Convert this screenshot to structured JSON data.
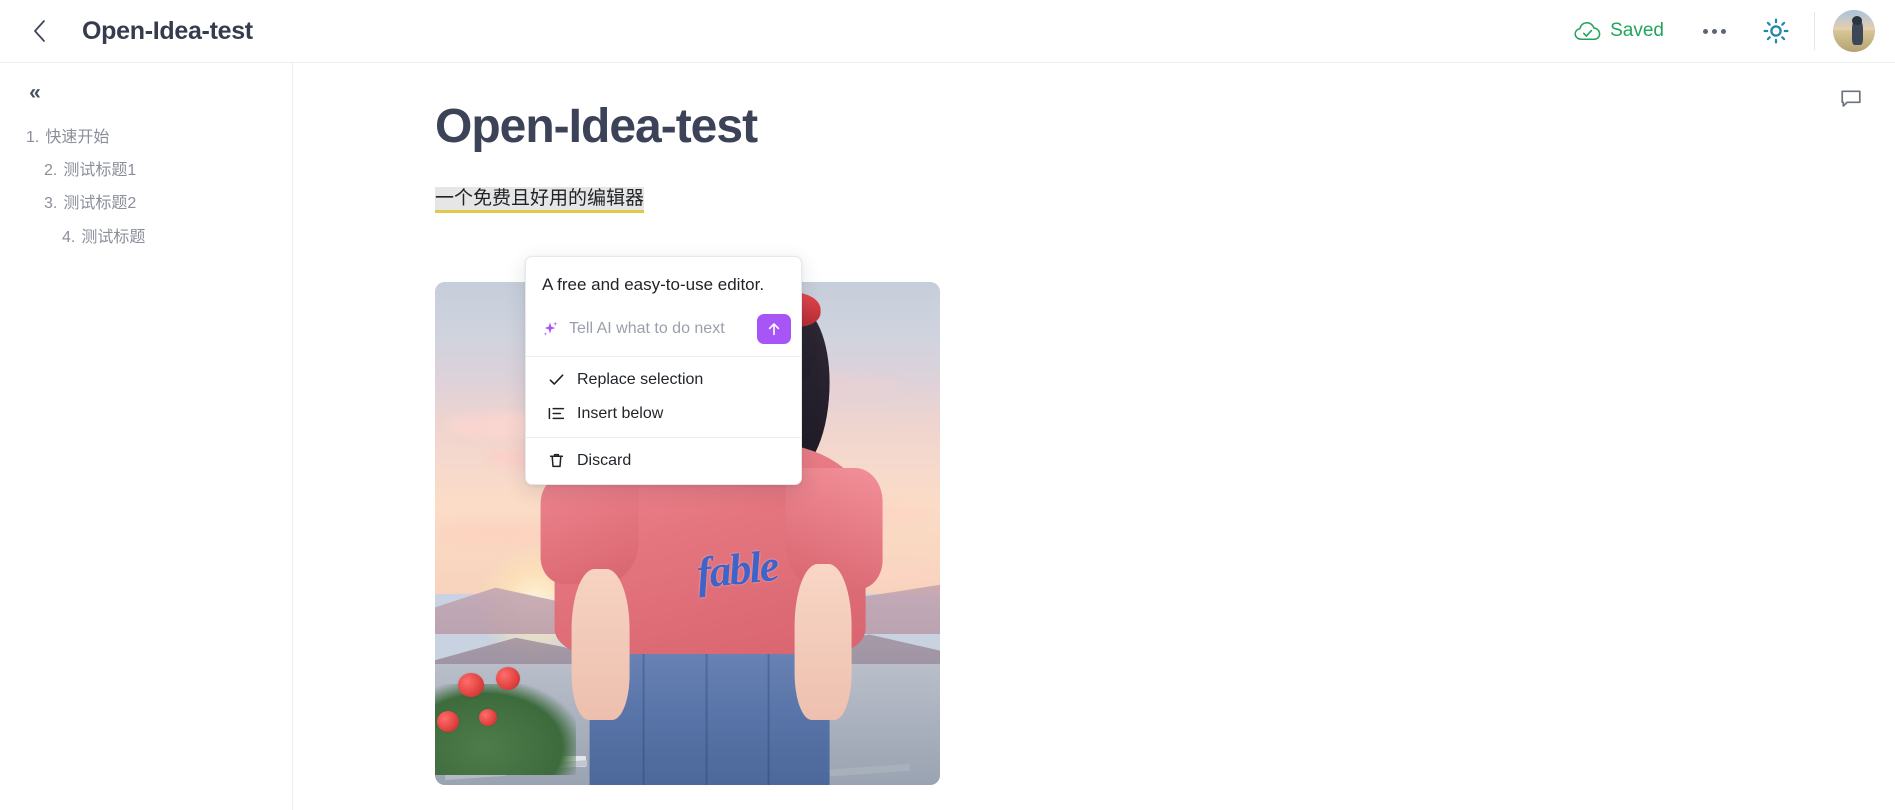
{
  "header": {
    "back_icon": "chevron-left-icon",
    "title": "Open-Idea-test",
    "save_status": "Saved",
    "save_icon": "cloud-check-icon",
    "more_icon": "ellipsis-icon",
    "theme_icon": "sun-icon",
    "avatar_icon": "user-avatar"
  },
  "sidebar": {
    "collapse_icon": "chevron-double-left-icon",
    "collapse_label": "«",
    "outline": [
      {
        "num": "1.",
        "label": "快速开始",
        "level": 0
      },
      {
        "num": "2.",
        "label": "测试标题1",
        "level": 1
      },
      {
        "num": "3.",
        "label": "测试标题2",
        "level": 1
      },
      {
        "num": "4.",
        "label": "测试标题",
        "level": 2
      }
    ]
  },
  "content": {
    "comment_icon": "comment-icon",
    "heading": "Open-Idea-test",
    "selected_paragraph": "一个免费且好用的编辑器",
    "image_alt": "anime-girl-sunset-illustration",
    "image_shirt_text": "fable"
  },
  "ai_panel": {
    "result_text": "A free and easy-to-use editor.",
    "sparkle_icon": "sparkle-icon",
    "input_value": "",
    "input_placeholder": "Tell AI what to do next",
    "send_icon": "arrow-up-icon",
    "menu": [
      {
        "icon": "check-icon",
        "label": "Replace selection"
      },
      {
        "icon": "insert-list-icon",
        "label": "Insert below"
      }
    ],
    "danger_menu": [
      {
        "icon": "trash-icon",
        "label": "Discard"
      }
    ]
  },
  "colors": {
    "accent_purple": "#a855f7",
    "saved_green": "#22a45d",
    "theme_teal": "#1e88a8",
    "title_navy": "#3c4257",
    "highlight_underline": "#e0c84a",
    "selection_bg": "#e6e6e6"
  }
}
